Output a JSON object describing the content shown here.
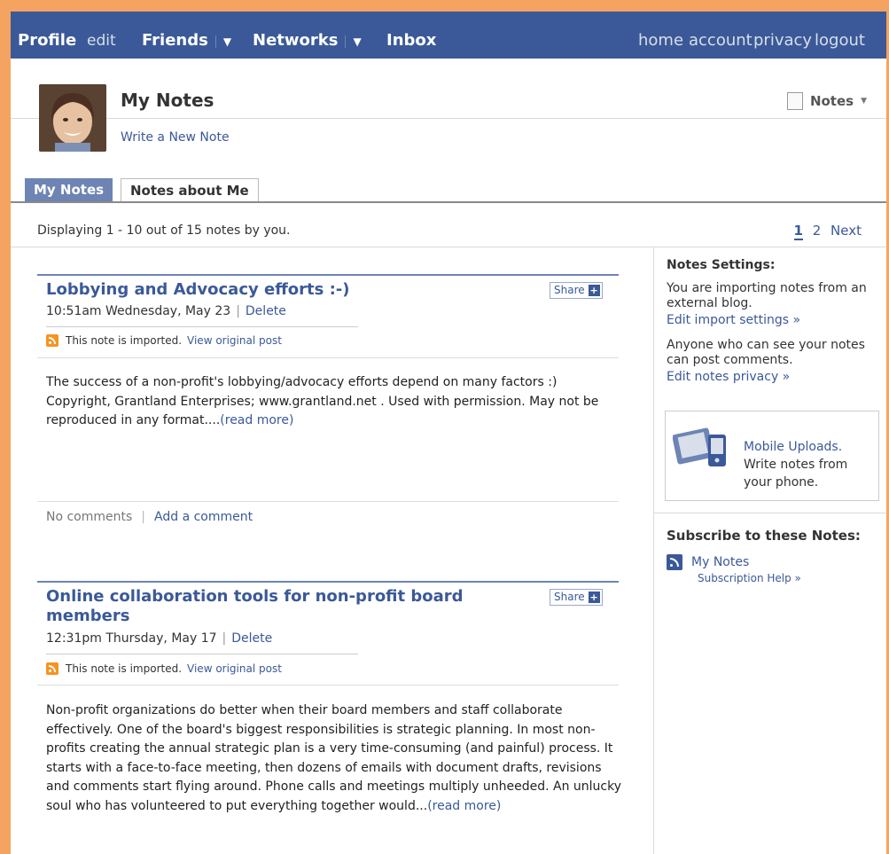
{
  "topbar": {
    "profile": "Profile",
    "edit": "edit",
    "friends": "Friends",
    "networks": "Networks",
    "caret": "▼",
    "inbox": "Inbox",
    "home": "home",
    "account": "account",
    "privacy": "privacy",
    "logout": "logout"
  },
  "header": {
    "title": "My Notes",
    "write_new": "Write a New Note",
    "notes_menu": "Notes",
    "notes_caret": "▼"
  },
  "tabs": [
    {
      "label": "My Notes",
      "active": true
    },
    {
      "label": "Notes about Me",
      "active": false
    }
  ],
  "listing": {
    "displaying": "Displaying 1 - 10 out of 15 notes by you.",
    "page_current": "1",
    "page_2": "2",
    "next": "Next"
  },
  "notes": [
    {
      "title": "Lobbying and Advocacy efforts :-)",
      "time": "10:51am Wednesday, May 23",
      "sep": "|",
      "delete": "Delete",
      "share": "Share",
      "imported": "This note is imported.",
      "view_original": "View original post",
      "body": "The success of a non-profit's lobbying/advocacy efforts depend on many factors :) Copyright, Grantland Enterprises; www.grantland.net . Used with permission. May not be reproduced in any format....",
      "read_more": "(read more)",
      "no_comments": "No comments",
      "comment_sep": "|",
      "add_comment": "Add a comment"
    },
    {
      "title": "Online collaboration tools for non-profit board members",
      "time": "12:31pm Thursday, May 17",
      "sep": "|",
      "delete": "Delete",
      "share": "Share",
      "imported": "This note is imported.",
      "view_original": "View original post",
      "body": "Non-profit organizations do better when their board members and staff collaborate effectively. One of the board's biggest responsibilities is strategic planning. In most non-profits creating the annual strategic plan is a very time-consuming (and painful) process. It starts with a face-to-face meeting, then dozens of emails with document drafts, revisions and comments start flying around. Phone calls and meetings multiply unheeded. An unlucky soul who has volunteered to put everything together would...",
      "read_more": "(read more)"
    }
  ],
  "sidebar": {
    "settings_title": "Notes Settings:",
    "importing_text": "You are importing notes from an external blog.",
    "edit_import": "Edit import settings »",
    "privacy_text": "Anyone who can see your notes can post comments.",
    "edit_privacy": "Edit notes privacy »",
    "mobile_link": "Mobile Uploads.",
    "mobile_text1": "Write notes from",
    "mobile_text2": "your phone.",
    "subscribe_title": "Subscribe to these Notes:",
    "my_notes": "My Notes",
    "subscription_help": "Subscription Help »"
  }
}
